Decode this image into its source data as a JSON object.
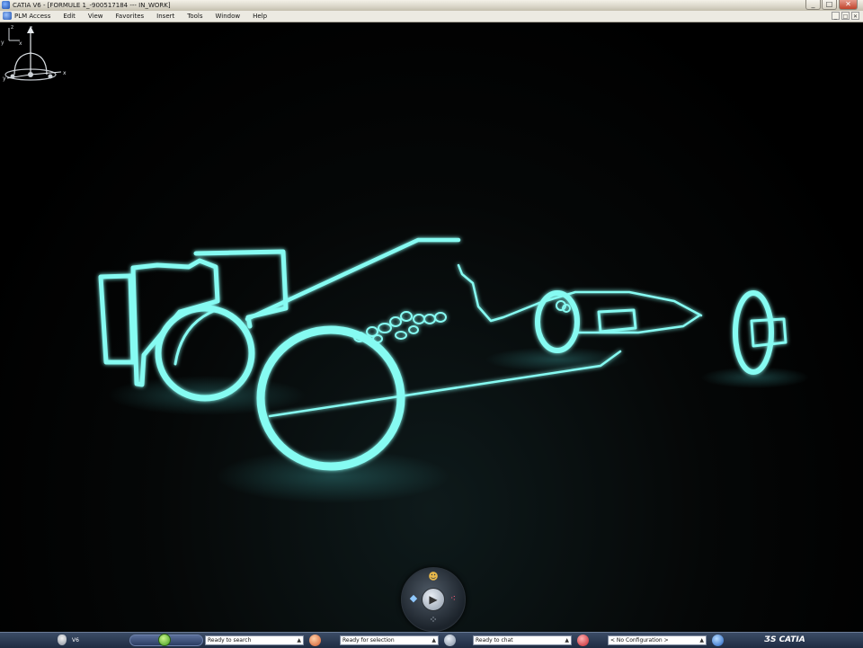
{
  "window": {
    "title": "CATIA V6 - [FORMULE 1_-900517184 --- IN_WORK]",
    "min_label": "_",
    "max_label": "□",
    "close_label": "✕"
  },
  "menu": {
    "items": [
      "PLM Access",
      "Edit",
      "View",
      "Favorites",
      "Insert",
      "Tools",
      "Window",
      "Help"
    ]
  },
  "compass": {
    "z_label": "z",
    "x_label": "x",
    "y_label": "y"
  },
  "axis_mini": {
    "z_label": "z",
    "x_label": "x",
    "y_label": "y"
  },
  "taskbar": {
    "v6_label": "V6",
    "search_status": "Ready to search",
    "selection_status": "Ready for selection",
    "chat_status": "Ready to chat",
    "configuration": "< No Configuration >",
    "brand": "CATIA"
  },
  "colors": {
    "glow": "#7ff6ee",
    "viewport_bg": "#000000",
    "taskbar": "#2a3a55"
  }
}
